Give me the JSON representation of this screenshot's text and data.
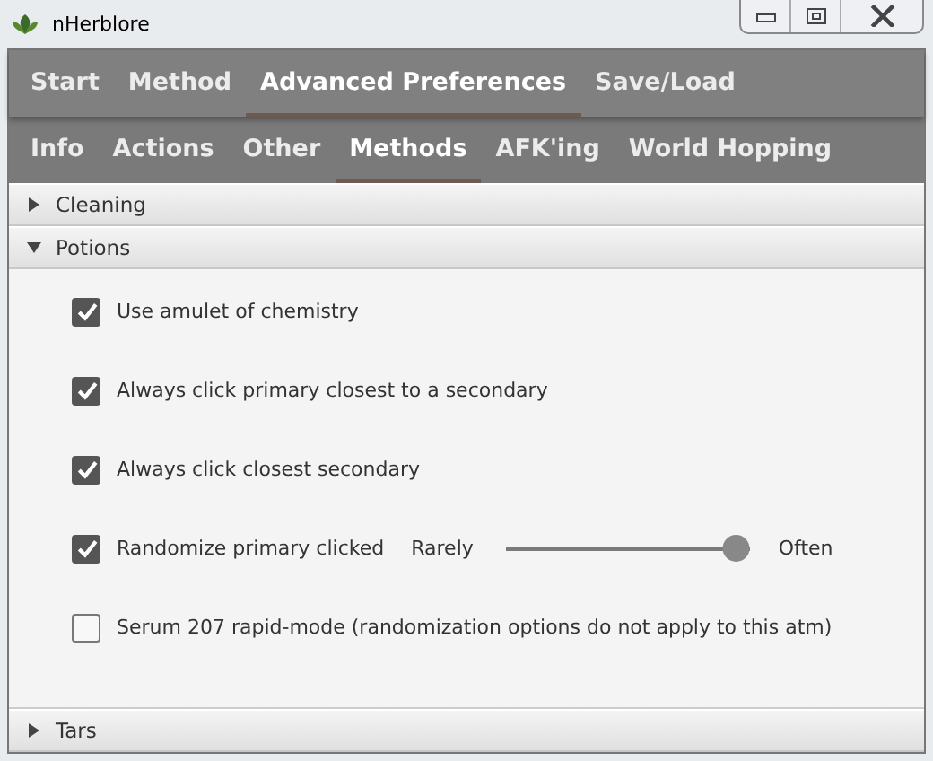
{
  "window": {
    "title": "nHerblore"
  },
  "main_tabs": [
    {
      "label": "Start",
      "selected": false
    },
    {
      "label": "Method",
      "selected": false
    },
    {
      "label": "Advanced Preferences",
      "selected": true
    },
    {
      "label": "Save/Load",
      "selected": false
    }
  ],
  "sub_tabs": [
    {
      "label": "Info",
      "selected": false
    },
    {
      "label": "Actions",
      "selected": false
    },
    {
      "label": "Other",
      "selected": false
    },
    {
      "label": "Methods",
      "selected": true
    },
    {
      "label": "AFK'ing",
      "selected": false
    },
    {
      "label": "World Hopping",
      "selected": false
    }
  ],
  "sections": [
    {
      "title": "Cleaning",
      "expanded": false
    },
    {
      "title": "Potions",
      "expanded": true,
      "options": [
        {
          "kind": "checkbox",
          "label": "Use amulet of chemistry",
          "checked": true
        },
        {
          "kind": "checkbox",
          "label": "Always click primary closest to a secondary",
          "checked": true
        },
        {
          "kind": "checkbox",
          "label": "Always click closest secondary",
          "checked": true
        },
        {
          "kind": "slider",
          "label": "Randomize primary clicked",
          "checked": true,
          "min_label": "Rarely",
          "max_label": "Often",
          "level": 0.95
        },
        {
          "kind": "checkbox",
          "label": "Serum 207 rapid-mode (randomization options do not apply to this atm)",
          "checked": false
        }
      ]
    },
    {
      "title": "Tars",
      "expanded": false
    }
  ]
}
